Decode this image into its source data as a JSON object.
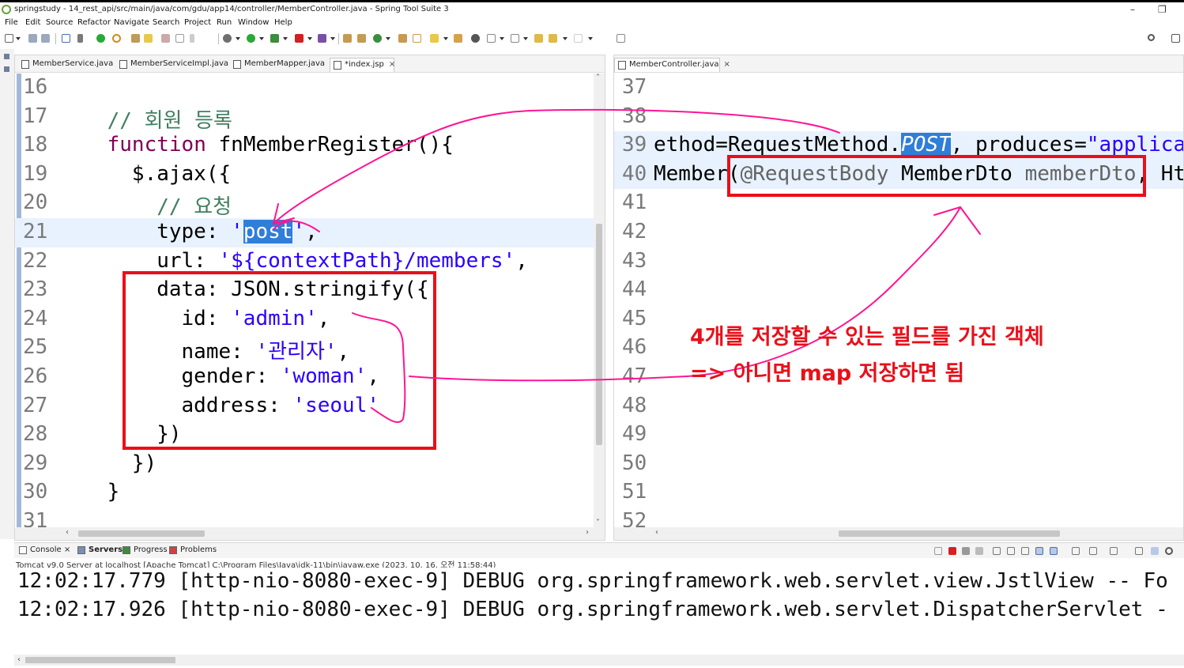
{
  "window": {
    "title": "springstudy - 14_rest_api/src/main/java/com/gdu/app14/controller/MemberController.java - Spring Tool Suite 3",
    "minimize": "–",
    "restore": "❐"
  },
  "menu": [
    "File",
    "Edit",
    "Source",
    "Refactor",
    "Navigate",
    "Search",
    "Project",
    "Run",
    "Window",
    "Help"
  ],
  "left_editor": {
    "tabs": [
      {
        "label": "MemberService.java",
        "active": false
      },
      {
        "label": "MemberServiceImpl.java",
        "active": false
      },
      {
        "label": "MemberMapper.java",
        "active": false
      },
      {
        "label": "*index.jsp",
        "active": true,
        "close": "×"
      }
    ],
    "lines": [
      {
        "n": "16",
        "parts": []
      },
      {
        "n": "17",
        "parts": [
          {
            "t": "    "
          },
          {
            "t": "// 회원 등록",
            "c": "cm"
          }
        ]
      },
      {
        "n": "18",
        "parts": [
          {
            "t": "    "
          },
          {
            "t": "function",
            "c": "kw"
          },
          {
            "t": " fnMemberRegister(){"
          }
        ]
      },
      {
        "n": "19",
        "parts": [
          {
            "t": "      $.ajax({"
          }
        ]
      },
      {
        "n": "20",
        "parts": [
          {
            "t": "        "
          },
          {
            "t": "// 요청",
            "c": "cm"
          }
        ]
      },
      {
        "n": "21",
        "parts": [
          {
            "t": "        type: "
          },
          {
            "t": "'",
            "c": "st"
          },
          {
            "t": "post",
            "c": "sel"
          },
          {
            "t": "'",
            "c": "st"
          },
          {
            "t": ","
          }
        ],
        "current": true
      },
      {
        "n": "22",
        "parts": [
          {
            "t": "        url: "
          },
          {
            "t": "'${contextPath}/members'",
            "c": "st"
          },
          {
            "t": ","
          }
        ]
      },
      {
        "n": "23",
        "parts": [
          {
            "t": "        data: JSON.stringify({"
          }
        ]
      },
      {
        "n": "24",
        "parts": [
          {
            "t": "          id: "
          },
          {
            "t": "'admin'",
            "c": "st"
          },
          {
            "t": ","
          }
        ]
      },
      {
        "n": "25",
        "parts": [
          {
            "t": "          name: "
          },
          {
            "t": "'관리자'",
            "c": "st"
          },
          {
            "t": ","
          }
        ]
      },
      {
        "n": "26",
        "parts": [
          {
            "t": "          gender: "
          },
          {
            "t": "'woman'",
            "c": "st"
          },
          {
            "t": ","
          }
        ]
      },
      {
        "n": "27",
        "parts": [
          {
            "t": "          address: "
          },
          {
            "t": "'seoul'",
            "c": "st"
          }
        ]
      },
      {
        "n": "28",
        "parts": [
          {
            "t": "        })"
          }
        ]
      },
      {
        "n": "29",
        "parts": [
          {
            "t": "      })"
          }
        ]
      },
      {
        "n": "30",
        "parts": [
          {
            "t": "    }"
          }
        ]
      },
      {
        "n": "31",
        "parts": []
      }
    ]
  },
  "right_editor": {
    "tabs": [
      {
        "label": "MemberController.java",
        "active": true,
        "close": "×"
      }
    ],
    "lines": [
      {
        "n": "37",
        "parts": []
      },
      {
        "n": "38",
        "parts": []
      },
      {
        "n": "39",
        "parts": [
          {
            "t": "ethod=RequestMethod."
          },
          {
            "t": "POST",
            "c": "fldsel"
          },
          {
            "t": ", produces="
          },
          {
            "t": "\"applica",
            "c": "st"
          }
        ],
        "current": true
      },
      {
        "n": "40",
        "parts": [
          {
            "t": "Member("
          },
          {
            "t": "@RequestBody",
            "c": "annot"
          },
          {
            "t": " MemberDto "
          },
          {
            "t": "memberDto",
            "c": "annot"
          },
          {
            "t": ", Ht"
          }
        ],
        "current": true
      },
      {
        "n": "41",
        "parts": []
      },
      {
        "n": "42",
        "parts": []
      },
      {
        "n": "43",
        "parts": []
      },
      {
        "n": "44",
        "parts": []
      },
      {
        "n": "45",
        "parts": []
      },
      {
        "n": "46",
        "parts": []
      },
      {
        "n": "47",
        "parts": []
      },
      {
        "n": "48",
        "parts": []
      },
      {
        "n": "49",
        "parts": []
      },
      {
        "n": "50",
        "parts": []
      },
      {
        "n": "51",
        "parts": []
      },
      {
        "n": "52",
        "parts": []
      }
    ]
  },
  "console": {
    "tabs": [
      {
        "label": "Console",
        "close": "×"
      },
      {
        "label": "Servers",
        "bold": true
      },
      {
        "label": "Progress"
      },
      {
        "label": "Problems"
      }
    ],
    "server_line": "Tomcat v9.0 Server at localhost [Apache Tomcat] C:\\Program Files\\Java\\jdk-11\\bin\\javaw.exe  (2023. 10. 16. 오전 11:58:44)",
    "lines": [
      "12:02:17.779 [http-nio-8080-exec-9] DEBUG org.springframework.web.servlet.view.JstlView -- Fo",
      "12:02:17.926 [http-nio-8080-exec-9] DEBUG org.springframework.web.servlet.DispatcherServlet -"
    ]
  },
  "annotation": {
    "line1": "4개를 저장할 수 있는 필드를 가진 객체",
    "line2": "=> 아니면 map 저장하면 됨",
    "color": "#e8101a",
    "arrow_color": "#ff1493"
  }
}
